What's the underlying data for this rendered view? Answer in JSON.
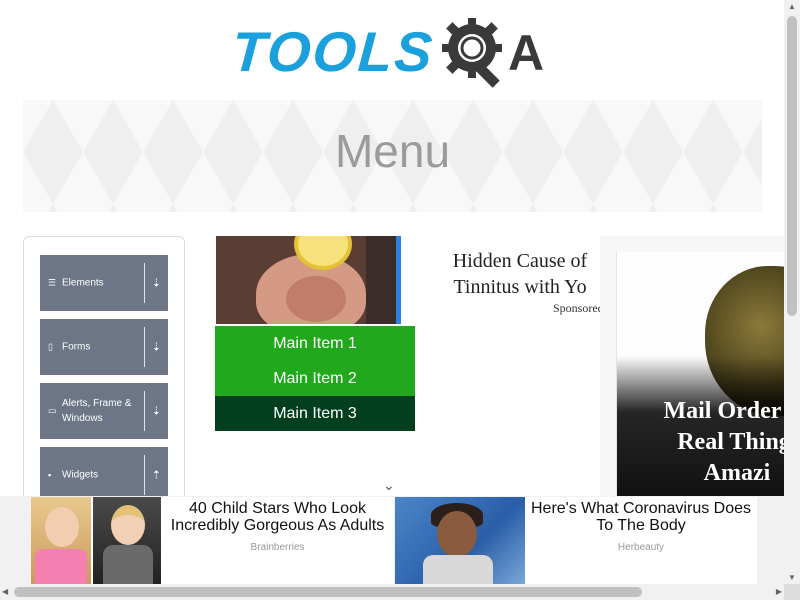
{
  "logo": {
    "text": "TOOLS",
    "suffix": "A",
    "brand_color": "#1aa0dc"
  },
  "banner": {
    "title": "Menu"
  },
  "sidebar": {
    "groups": [
      {
        "label": "Elements",
        "icon": "list-icon",
        "chevron": "⇣"
      },
      {
        "label": "Forms",
        "icon": "document-icon",
        "chevron": "⇣"
      },
      {
        "label": "Alerts, Frame & Windows",
        "icon": "window-icon",
        "chevron": "⇣"
      },
      {
        "label": "Widgets",
        "icon": "grid-icon",
        "chevron": "⇡"
      }
    ]
  },
  "ad_top": {
    "headline": "Hidden Cause of Tinnitus with Yo",
    "sponsored": "Sponsored"
  },
  "menu": {
    "items": [
      {
        "label": "Main Item 1"
      },
      {
        "label": "Main Item 2"
      },
      {
        "label": "Main Item 3"
      }
    ],
    "colors": {
      "item": "#21a81d",
      "hover": "#013f1f"
    }
  },
  "ad_right": {
    "text_lines": [
      "Mail Order W",
      "Real Thing,",
      "Amazi"
    ]
  },
  "bottom_ads": [
    {
      "title": "40 Child Stars Who Look Incredibly Gorgeous As Adults",
      "source": "Brainberries"
    },
    {
      "title": "Here's What Coronavirus Does To The Body",
      "source": "Herbeauty"
    }
  ],
  "scroll": {
    "chevron_down": "⌄"
  }
}
